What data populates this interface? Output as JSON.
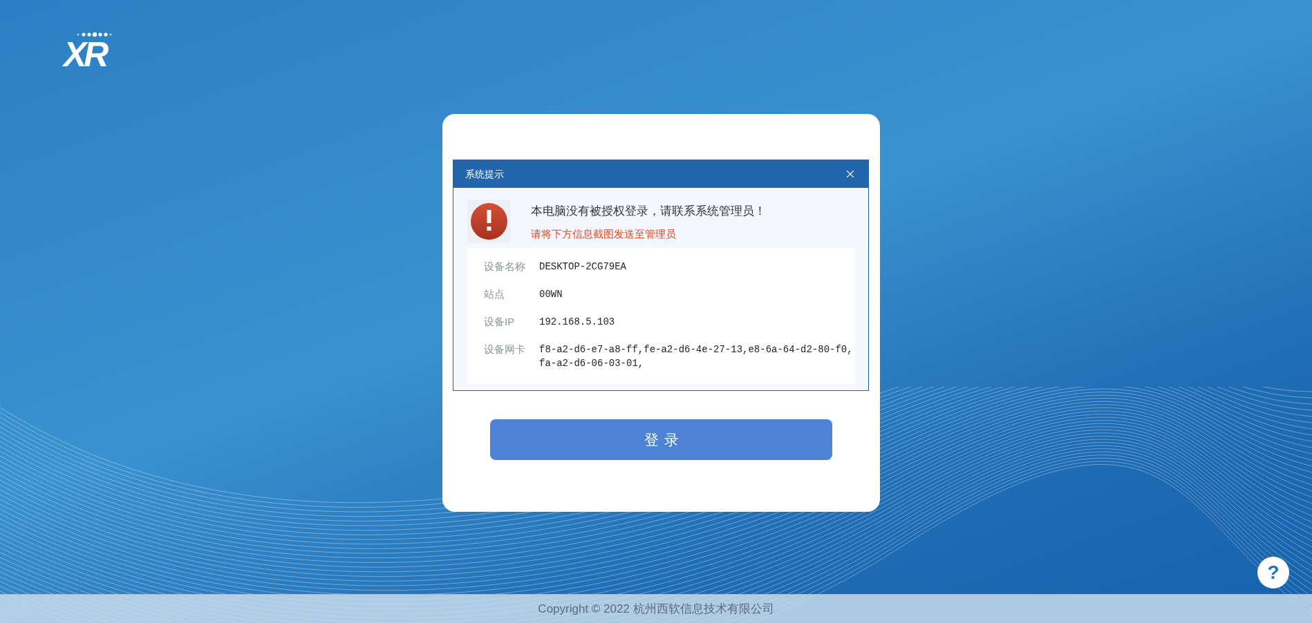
{
  "logo": {
    "text": "XR"
  },
  "login_card": {
    "button": "登录"
  },
  "dialog": {
    "title": "系统提示",
    "message": "本电脑没有被授权登录，请联系系统管理员！",
    "hint": "请将下方信息截图发送至管理员",
    "fields": [
      {
        "label": "设备名称",
        "value": "DESKTOP-2CG79EA"
      },
      {
        "label": "站点",
        "value": "00WN"
      },
      {
        "label": "设备IP",
        "value": "192.168.5.103"
      },
      {
        "label": "设备网卡",
        "value": "f8-a2-d6-e7-a8-ff,fe-a2-d6-4e-27-13,e8-6a-64-d2-80-f0,fa-a2-d6-06-03-01,"
      }
    ]
  },
  "help_button": "?",
  "footer": "Copyright © 2022 杭州西软信息技术有限公司"
}
